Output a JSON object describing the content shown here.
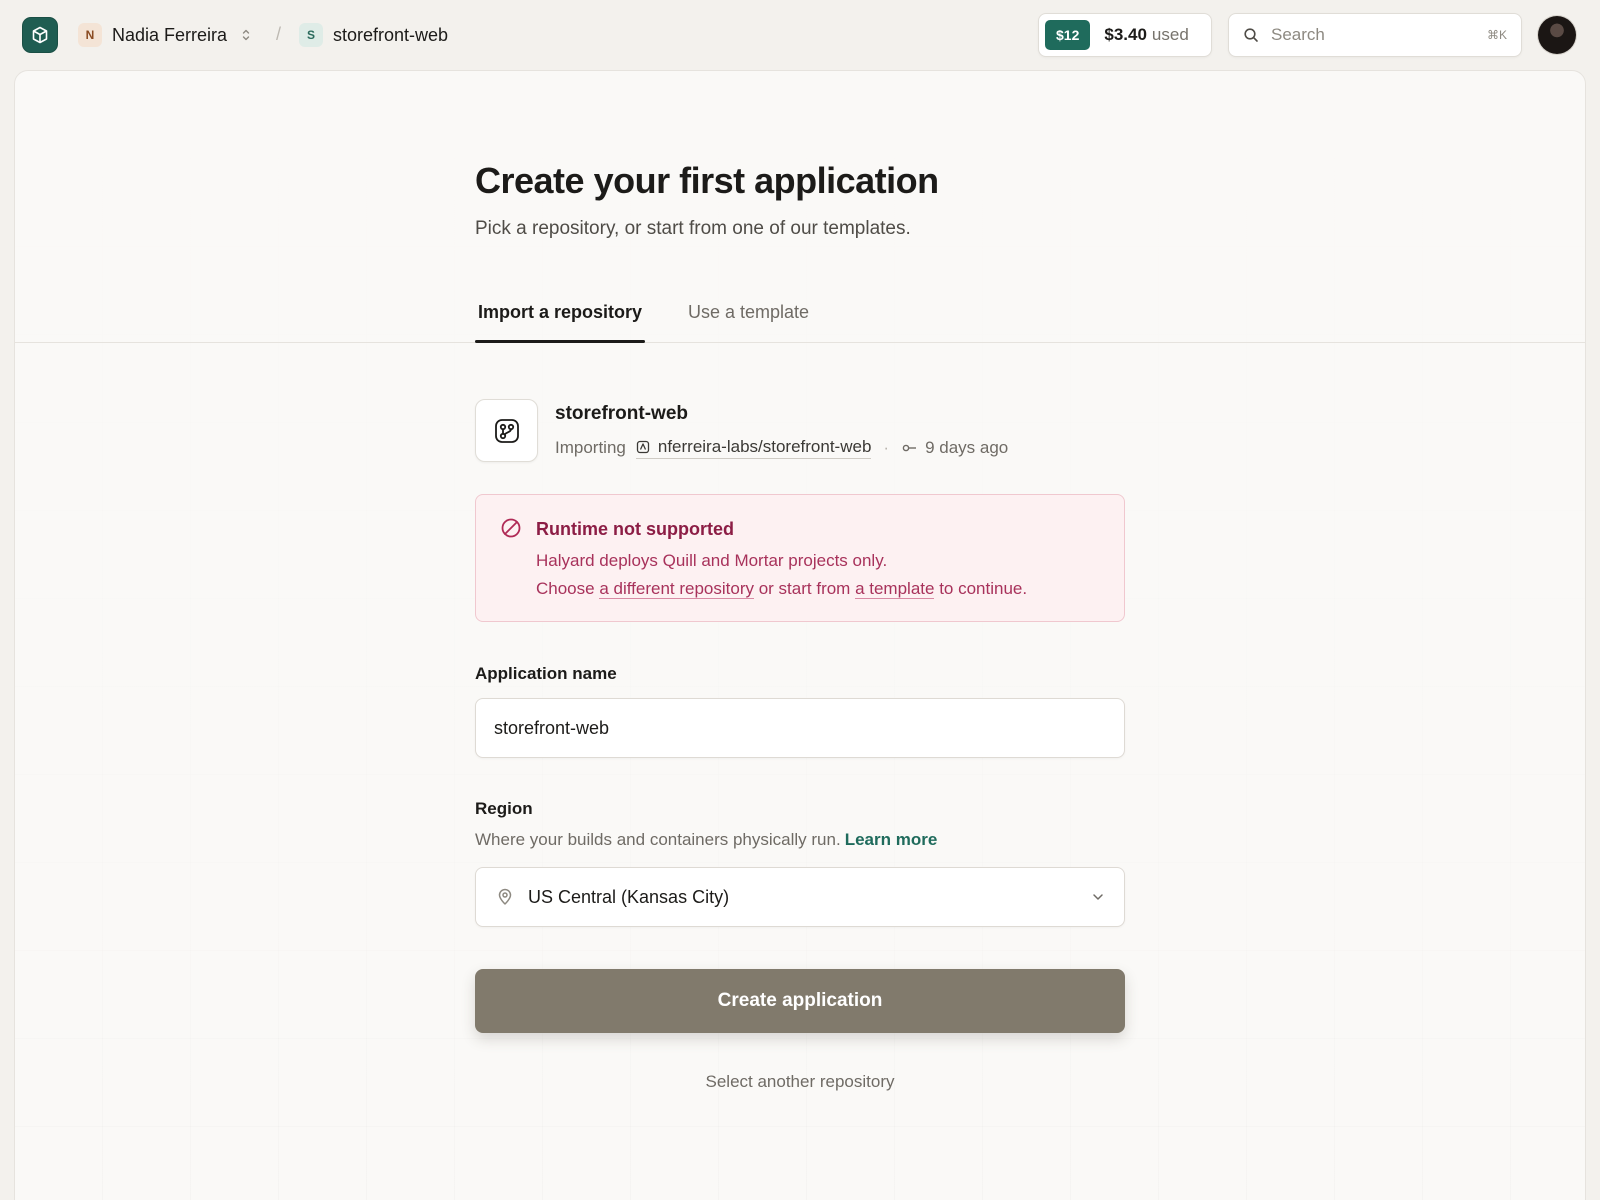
{
  "header": {
    "org": {
      "initial": "N",
      "name": "Nadia Ferreira"
    },
    "separator": "/",
    "project": {
      "initial": "S",
      "name": "storefront-web"
    },
    "usage": {
      "limit": "$12",
      "amount": "$3.40",
      "label": "used"
    },
    "search": {
      "placeholder": "Search",
      "shortcut": "⌘K"
    }
  },
  "page": {
    "title": "Create your first application",
    "subtitle": "Pick a repository, or start from one of our templates.",
    "tabs": [
      {
        "label": "Import a repository",
        "active": true
      },
      {
        "label": "Use a template",
        "active": false
      }
    ]
  },
  "repo": {
    "name": "storefront-web",
    "status": "Importing",
    "full_name": "nferreira-labs/storefront-web",
    "meta_separator": "·",
    "last_commit": "9 days ago"
  },
  "alert": {
    "title": "Runtime not supported",
    "line1": "Halyard deploys Quill and Mortar projects only.",
    "line2_prefix": "Choose ",
    "line2_link1": "a different repository",
    "line2_middle": " or start from ",
    "line2_link2": "a template",
    "line2_suffix": " to continue."
  },
  "form": {
    "name_label": "Application name",
    "name_value": "storefront-web",
    "region_label": "Region",
    "region_help": "Where your builds and containers physically run.",
    "region_learn_more": "Learn more",
    "region_value": "US Central (Kansas City)",
    "create_button": "Create application",
    "select_another": "Select another repository"
  },
  "colors": {
    "accent": "#1f6b5c",
    "alert_text": "#a8325b",
    "alert_bg": "#fdf1f2",
    "button_disabled": "#817a6c"
  },
  "icons": {
    "app_logo": "cube-icon",
    "org_switcher": "chevron-updown-icon",
    "search": "search-icon",
    "repo": "git-branch-icon",
    "repo_link": "repo-icon",
    "commit": "commit-icon",
    "alert": "prohibited-icon",
    "region": "map-pin-icon",
    "select": "chevron-down-icon"
  }
}
